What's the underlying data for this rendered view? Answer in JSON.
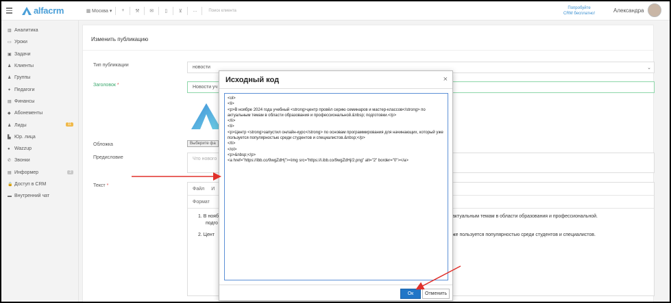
{
  "app": {
    "logo_text": "alfacrm"
  },
  "toolbar": {
    "branch": "Москва ▾",
    "search_placeholder": "Поиск клиента",
    "ellipsis": "..."
  },
  "promo": {
    "line1": "Попробуйте",
    "line2": "CRM бесплатно!"
  },
  "user": {
    "name": "Александра"
  },
  "sidebar": {
    "items": [
      {
        "label": "Аналитика",
        "icon": "▥"
      },
      {
        "label": "Уроки",
        "icon": "▭"
      },
      {
        "label": "Задачи",
        "icon": "▣"
      },
      {
        "label": "Клиенты",
        "icon": "♟"
      },
      {
        "label": "Группы",
        "icon": "♟"
      },
      {
        "label": "Педагоги",
        "icon": "✦"
      },
      {
        "label": "Финансы",
        "icon": "▤"
      },
      {
        "label": "Абонементы",
        "icon": "◆"
      },
      {
        "label": "Лиды",
        "icon": "♟",
        "badge": "11"
      },
      {
        "label": "Юр. лица",
        "icon": "▙"
      },
      {
        "label": "Wazzup",
        "icon": "●"
      },
      {
        "label": "Звонки",
        "icon": "✆"
      },
      {
        "label": "Информер",
        "icon": "▤",
        "badge": "2"
      },
      {
        "label": "Доступ в CRM",
        "icon": "🔒"
      },
      {
        "label": "Внутренний чат",
        "icon": "▬"
      }
    ]
  },
  "form": {
    "title": "Изменить публикацию",
    "type_label": "Тип публикации",
    "type_value": "новости",
    "heading_label": "Заголовок",
    "heading_value": "Новости уч",
    "cover_label": "Обложка",
    "cover_button": "Выберите фа",
    "preface_label": "Предисловие",
    "preface_placeholder": "Что нового",
    "text_label": "Текст",
    "editor_menu_file": "Файл",
    "editor_menu_more": "И",
    "editor_format": "Формат",
    "editor_line1a": "1. В нояб",
    "editor_line1b": "актуальным темам в области образования и профессиональной.",
    "editor_line1c": "подго",
    "editor_line2a": "2. Цент",
    "editor_line2b": "же пользуется популярностью среди студентов и специалистов."
  },
  "dialog": {
    "title": "Исходный код",
    "close": "×",
    "code": "<ol>\n<li>\n<p>В ноябре 2024 года учебный <strong>центр провёл серию семинаров и мастер-классов</strong> по актуальным темам в области образования и профессиональной.&nbsp; подготовки.</p>\n</li>\n<li>\n<p>Центр <strong>запустил онлайн-курс</strong> по основам программирования для начинающих, который уже пользуется популярностью среди студентов и специалистов.&nbsp;</p>\n</li>\n</ol>\n<p>&nbsp;</p>\n<a href=\"https://ibb.co/9wgZdHj\"><img src=\"https://i.ibb.co/9wgZdHj/2.png\" alt=\"2\" border=\"0\"></a>",
    "ok": "Ок",
    "cancel": "Отменить"
  },
  "colors": {
    "accent": "#2176c7",
    "arrow": "#e0302a",
    "brand": "#4a9fd8"
  }
}
